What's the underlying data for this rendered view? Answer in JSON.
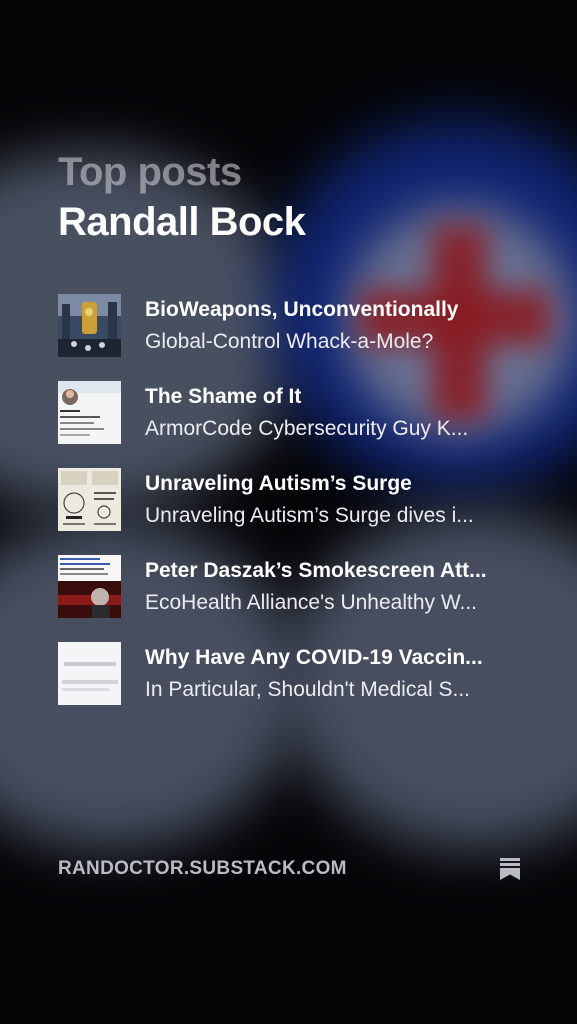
{
  "header": {
    "kicker": "Top posts",
    "author": "Randall Bock"
  },
  "posts": [
    {
      "title": "BioWeapons, Unconventionally",
      "subtitle": "Global-Control Whack-a-Mole?",
      "thumb_icon": "illustration-thumbnail"
    },
    {
      "title": "The Shame of It",
      "subtitle": "ArmorCode Cybersecurity Guy K...",
      "thumb_icon": "profile-screenshot-thumbnail"
    },
    {
      "title": "Unraveling Autism’s Surge",
      "subtitle": "Unraveling Autism’s Surge dives i...",
      "thumb_icon": "infographic-thumbnail"
    },
    {
      "title": "Peter Daszak’s Smokescreen Att...",
      "subtitle": "EcoHealth Alliance's Unhealthy W...",
      "thumb_icon": "news-screenshot-thumbnail"
    },
    {
      "title": "Why Have Any COVID-19 Vaccin...",
      "subtitle": "In Particular, Shouldn't Medical S...",
      "thumb_icon": "document-thumbnail"
    }
  ],
  "footer": {
    "domain": "RANDOCTOR.SUBSTACK.COM",
    "logo_icon": "substack-logo-icon"
  },
  "colors": {
    "background": "#050608",
    "title_primary": "#ffffff",
    "title_muted": "#c8c8cd",
    "cross_red": "#b0242c",
    "blue": "#16329a"
  }
}
